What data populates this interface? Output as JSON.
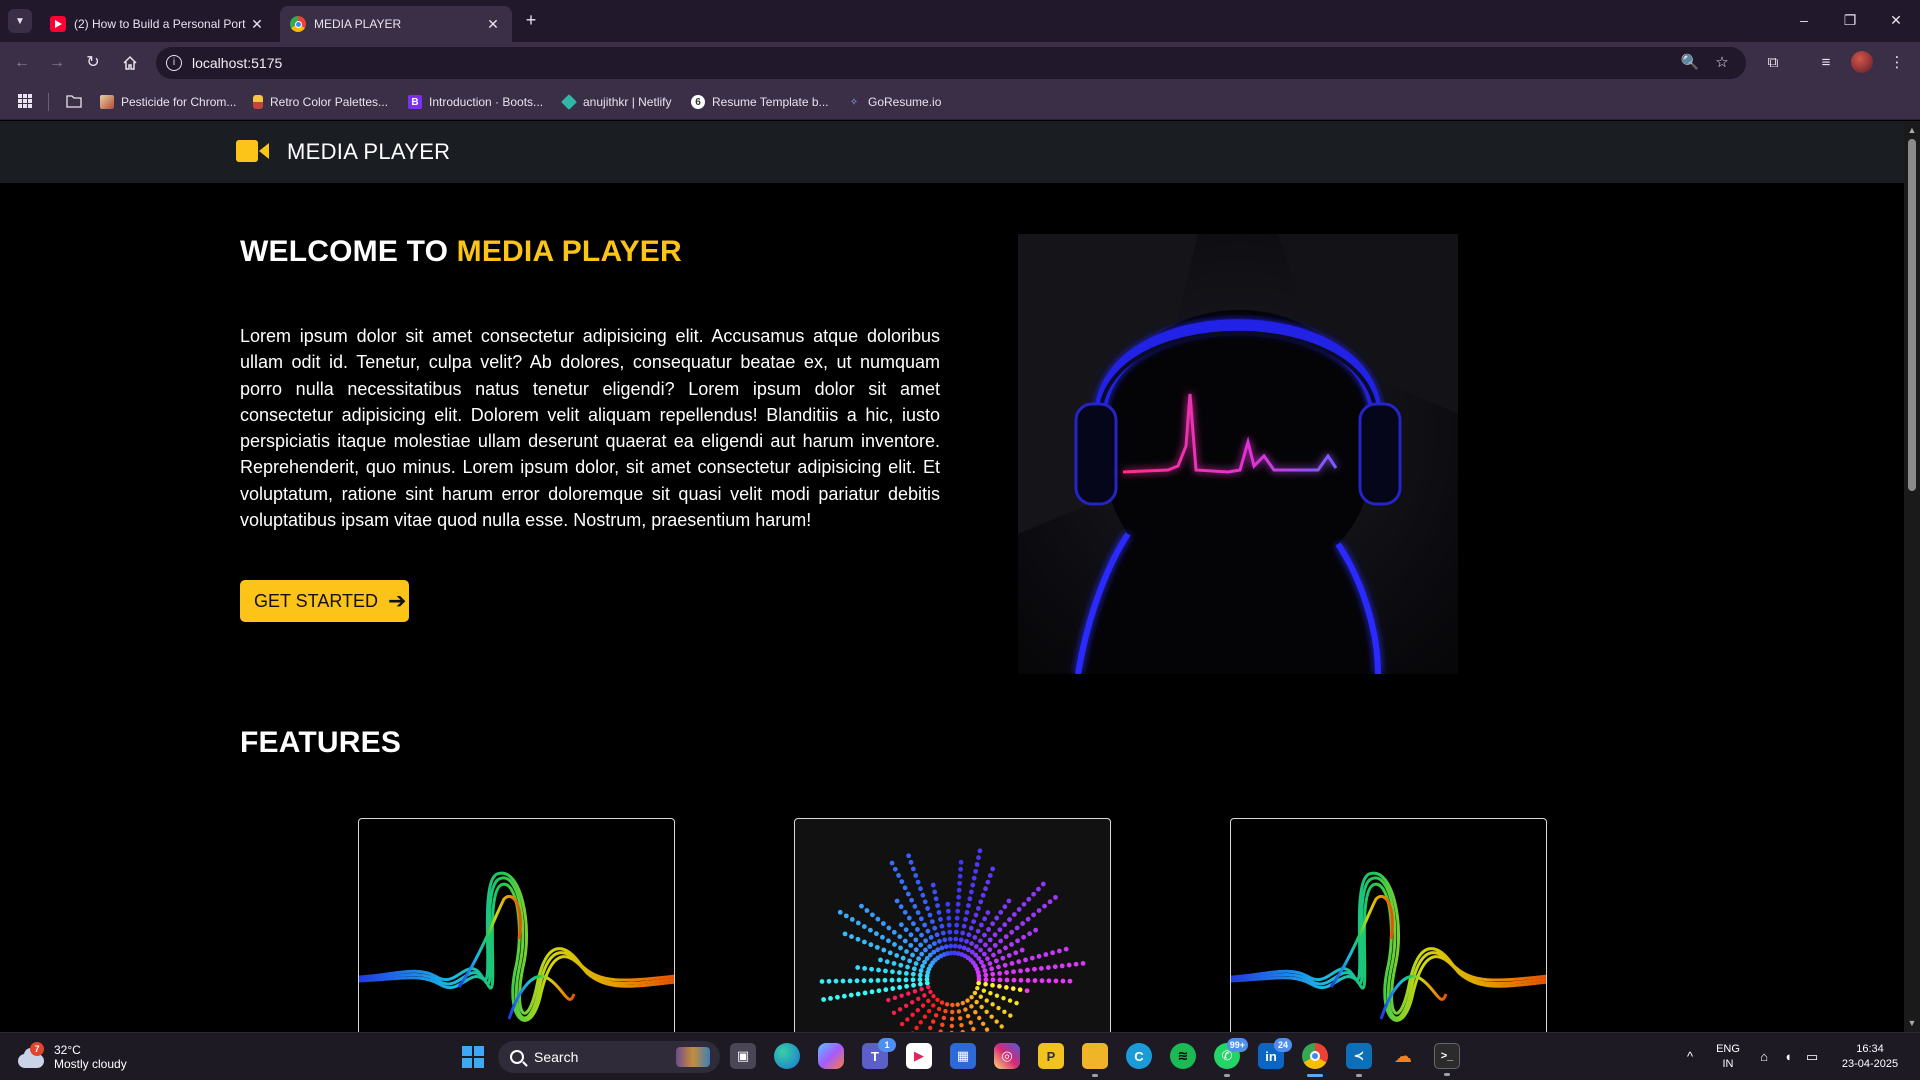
{
  "browser": {
    "tabs": [
      {
        "title": "(2) How to Build a Personal Port",
        "close": "✕"
      },
      {
        "title": "MEDIA PLAYER",
        "close": "✕"
      }
    ],
    "new_tab": "+",
    "window_controls": {
      "minimize": "–",
      "restore": "❐",
      "close": "✕"
    },
    "url": "localhost:5175",
    "bookmarks": [
      {
        "label": "Pesticide for Chrom..."
      },
      {
        "label": "Retro Color Palettes..."
      },
      {
        "label": "Introduction · Boots..."
      },
      {
        "label": "anujithkr | Netlify"
      },
      {
        "label": "Resume Template b..."
      },
      {
        "label": "GoResume.io"
      }
    ]
  },
  "site": {
    "brand": "MEDIA PLAYER",
    "accent_color": "#fcc419",
    "hero": {
      "title_prefix": "WELCOME TO ",
      "title_accent": "MEDIA PLAYER",
      "body": "Lorem ipsum dolor sit amet consectetur adipisicing elit. Accusamus atque doloribus ullam odit id. Tenetur, culpa velit? Ab dolores, consequatur beatae ex, ut numquam porro nulla necessitatibus natus tenetur eligendi? Lorem ipsum dolor sit amet consectetur adipisicing elit. Dolorem velit aliquam repellendus! Blanditiis a hic, iusto perspiciatis itaque molestiae ullam deserunt quaerat ea eligendi aut harum inventore. Reprehenderit, quo minus. Lorem ipsum dolor, sit amet consectetur adipisicing elit. Et voluptatum, ratione sint harum error doloremque sit quasi velit modi pariatur debitis voluptatibus ipsam vitae quod nulla esse. Nostrum, praesentium harum!",
      "cta_label": "GET STARTED",
      "cta_arrow": "➔"
    },
    "features_title": "FEATURES"
  },
  "taskbar": {
    "weather": {
      "temp": "32°C",
      "condition": "Mostly cloudy",
      "badge": "7"
    },
    "search_placeholder": "Search",
    "badges": {
      "whatsapp": "99+",
      "linkedin": "24",
      "teams": "1"
    },
    "lang": {
      "line1": "ENG",
      "line2": "IN"
    },
    "clock": {
      "time": "16:34",
      "date": "23-04-2025"
    }
  }
}
